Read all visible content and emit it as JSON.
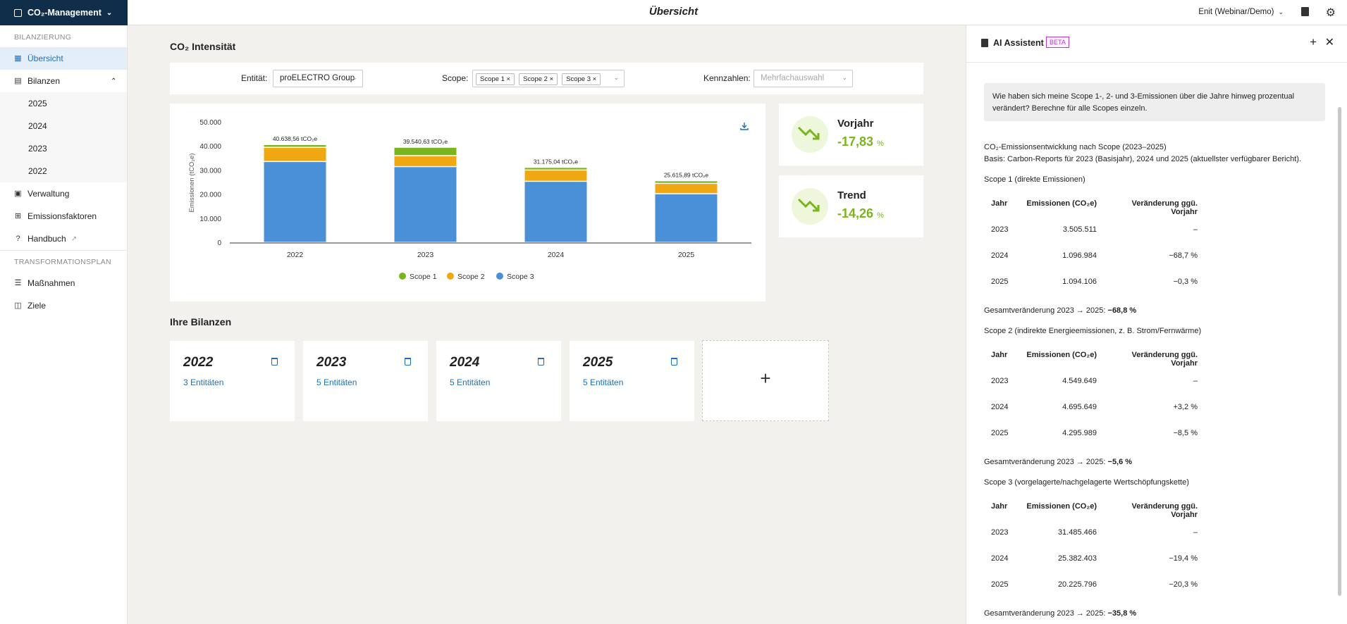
{
  "header": {
    "app_name": "CO₂-Management",
    "page_title": "Übersicht",
    "user": "Enit (Webinar/Demo)"
  },
  "sidebar": {
    "section1": "BILANZIERUNG",
    "items": [
      {
        "label": "Übersicht"
      },
      {
        "label": "Bilanzen"
      }
    ],
    "years": [
      "2025",
      "2024",
      "2023",
      "2022"
    ],
    "items2": [
      {
        "label": "Verwaltung"
      },
      {
        "label": "Emissionsfaktoren"
      },
      {
        "label": "Handbuch"
      }
    ],
    "section2": "TRANSFORMATIONSPLAN",
    "items3": [
      {
        "label": "Maßnahmen"
      },
      {
        "label": "Ziele"
      }
    ]
  },
  "main": {
    "title": "CO₂ Intensität",
    "filters": {
      "entity_label": "Entität:",
      "entity_value": "proELECTRO Group",
      "scope_label": "Scope:",
      "scopes": [
        "Scope 1",
        "Scope 2",
        "Scope 3"
      ],
      "kpi_label": "Kennzahlen:",
      "kpi_placeholder": "Mehrfachauswahl"
    },
    "kpis": [
      {
        "title": "Vorjahr",
        "value": "-17,83",
        "unit": "%"
      },
      {
        "title": "Trend",
        "value": "-14,26",
        "unit": "%"
      }
    ],
    "bilanzen_title": "Ihre Bilanzen",
    "bilanzen": [
      {
        "year": "2022",
        "entities": "3 Entitäten"
      },
      {
        "year": "2023",
        "entities": "5 Entitäten"
      },
      {
        "year": "2024",
        "entities": "5 Entitäten"
      },
      {
        "year": "2025",
        "entities": "5 Entitäten"
      }
    ],
    "add_label": "+"
  },
  "chart_data": {
    "type": "bar",
    "stacked": true,
    "categories": [
      "2022",
      "2023",
      "2024",
      "2025"
    ],
    "series": [
      {
        "name": "Scope 3",
        "color": "#4a90d6",
        "values": [
          33600,
          31485,
          25382,
          20226
        ]
      },
      {
        "name": "Scope 2",
        "color": "#f0a812",
        "values": [
          5900,
          4550,
          4696,
          4296
        ]
      },
      {
        "name": "Scope 1",
        "color": "#7ab51d",
        "values": [
          1139,
          3506,
          1097,
          1094
        ]
      }
    ],
    "totals": [
      "40.638,56 tCO₂e",
      "39.540,63 tCO₂e",
      "31.175,04 tCO₂e",
      "25.615,89 tCO₂e"
    ],
    "yticks": [
      "0",
      "10.000",
      "20.000",
      "30.000",
      "40.000",
      "50.000"
    ],
    "ylim": [
      0,
      50000
    ],
    "ylabel": "Emissionen (tCO₂e)",
    "legend": [
      "Scope 1",
      "Scope 2",
      "Scope 3"
    ],
    "legend_position": "bottom"
  },
  "assistant": {
    "title": "AI Assistent",
    "badge": "BETA",
    "question": "Wie haben sich meine Scope 1-, 2- und 3-Emissionen über die Jahre hinweg prozentual verändert? Berechne für alle Scopes einzeln.",
    "intro1": "CO₂-Emissionsentwicklung nach Scope (2023–2025)",
    "intro2": "Basis: Carbon-Reports für 2023 (Basisjahr), 2024 und 2025 (aktuellster verfügbarer Bericht).",
    "headers": [
      "Jahr",
      "Emissionen (CO₂e)",
      "Veränderung ggü. Vorjahr"
    ],
    "tables": [
      {
        "title": "Scope 1 (direkte Emissionen)",
        "rows": [
          [
            "2023",
            "3.505.511",
            "–"
          ],
          [
            "2024",
            "1.096.984",
            "−68,7 %"
          ],
          [
            "2025",
            "1.094.106",
            "−0,3 %"
          ]
        ],
        "total_label": "Gesamtveränderung 2023 → 2025:",
        "total_value": "−68,8 %"
      },
      {
        "title": "Scope 2 (indirekte Energieemissionen, z. B. Strom/Fernwärme)",
        "rows": [
          [
            "2023",
            "4.549.649",
            "–"
          ],
          [
            "2024",
            "4.695.649",
            "+3,2 %"
          ],
          [
            "2025",
            "4.295.989",
            "−8,5 %"
          ]
        ],
        "total_label": "Gesamtveränderung 2023 → 2025:",
        "total_value": "−5,6 %"
      },
      {
        "title": "Scope 3 (vorgelagerte/nachgelagerte Wertschöpfungskette)",
        "rows": [
          [
            "2023",
            "31.485.466",
            "–"
          ],
          [
            "2024",
            "25.382.403",
            "−19,4 %"
          ],
          [
            "2025",
            "20.225.796",
            "−20,3 %"
          ]
        ],
        "total_label": "Gesamtveränderung 2023 → 2025:",
        "total_value": "−35,8 %"
      }
    ]
  }
}
